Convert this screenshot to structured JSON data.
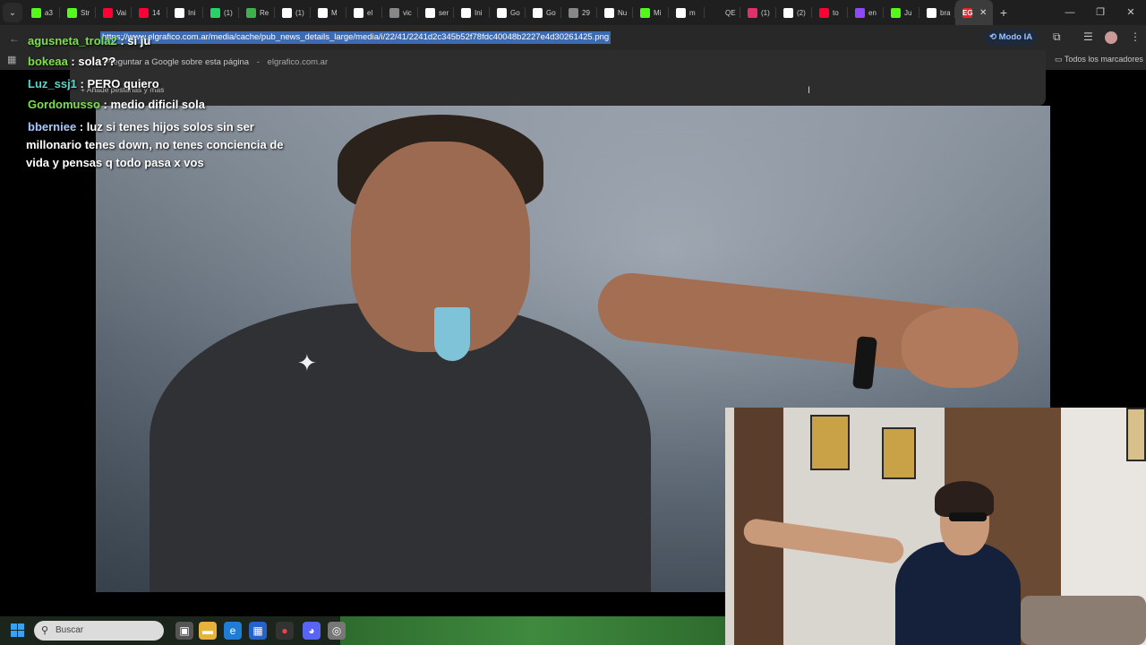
{
  "tabs": [
    {
      "label": "a3",
      "icon": "kick-icon",
      "color": "#53fc18"
    },
    {
      "label": "Str",
      "icon": "kick-icon",
      "color": "#53fc18"
    },
    {
      "label": "Vai",
      "icon": "youtube-icon",
      "color": "#ff0033"
    },
    {
      "label": "14",
      "icon": "youtube-icon",
      "color": "#ff0033"
    },
    {
      "label": "Ini",
      "icon": "x-icon",
      "color": "#ffffff"
    },
    {
      "label": "(1)",
      "icon": "whatsapp-icon",
      "color": "#25d366"
    },
    {
      "label": "Re",
      "icon": "puzzle-icon",
      "color": "#3db14b"
    },
    {
      "label": "(1)",
      "icon": "tiktok-icon",
      "color": "#ffffff"
    },
    {
      "label": "M",
      "icon": "tiktok-icon",
      "color": "#ffffff"
    },
    {
      "label": "el",
      "icon": "google-icon",
      "color": "#ffffff"
    },
    {
      "label": "vic",
      "icon": "globe-icon",
      "color": "#888888"
    },
    {
      "label": "ser",
      "icon": "tiktok-icon",
      "color": "#ffffff"
    },
    {
      "label": "Ini",
      "icon": "x-icon",
      "color": "#ffffff"
    },
    {
      "label": "Go",
      "icon": "google-icon",
      "color": "#ffffff"
    },
    {
      "label": "Go",
      "icon": "google-icon",
      "color": "#ffffff"
    },
    {
      "label": "29",
      "icon": "globe-icon",
      "color": "#888888"
    },
    {
      "label": "Nu",
      "icon": "github-icon",
      "color": "#ffffff"
    },
    {
      "label": "Mi",
      "icon": "kick-icon",
      "color": "#53fc18"
    },
    {
      "label": "m",
      "icon": "google-icon",
      "color": "#ffffff"
    },
    {
      "label": "QE",
      "icon": "blank-icon",
      "color": "#1f1f1f"
    },
    {
      "label": "(1)",
      "icon": "instagram-icon",
      "color": "#e1306c"
    },
    {
      "label": "(2)",
      "icon": "tiktok-icon",
      "color": "#ffffff"
    },
    {
      "label": "to",
      "icon": "youtube-icon",
      "color": "#ff0033"
    },
    {
      "label": "en",
      "icon": "twitch-icon",
      "color": "#9146ff"
    },
    {
      "label": "Ju",
      "icon": "kick-icon",
      "color": "#53fc18"
    },
    {
      "label": "bra",
      "icon": "google-icon",
      "color": "#ffffff"
    }
  ],
  "active_tab": {
    "label": "EG",
    "icon": "elgrafico-icon",
    "color": "#e4232b"
  },
  "toolbar": {
    "url": "https://www.elgrafico.com.ar/media/cache/pub_news_details_large/media/i/22/41/2241d2c345b52f78fdc40048b2227e4d30261425.png",
    "modo_ia": "Modo IA"
  },
  "dropdown": {
    "suggestion": "Preguntar a Google sobre esta página",
    "domain": "elgrafico.com.ar",
    "add_tabs": "Añade pestañas y más"
  },
  "bookmarks": {
    "all_label": "Todos los marcadores"
  },
  "chat": [
    {
      "user": "agusneta_trola2",
      "text": "si ju",
      "color": "#7ee04a"
    },
    {
      "user": "bokeaa",
      "text": "sola??",
      "color": "#7ee04a"
    },
    {
      "user": "Luz_ssj1",
      "text": "PERO quiero",
      "color": "#5cd6c8"
    },
    {
      "user": "Gordomusso",
      "text": "medio dificil sola",
      "color": "#7ee04a"
    },
    {
      "user": "bberniee",
      "text": "luz si tenes hijos solos sin ser millonario tenes down, no tenes conciencia de vida y pensas q todo pasa x vos",
      "color": "#a9c8ff"
    }
  ],
  "taskbar": {
    "search_placeholder": "Buscar"
  }
}
